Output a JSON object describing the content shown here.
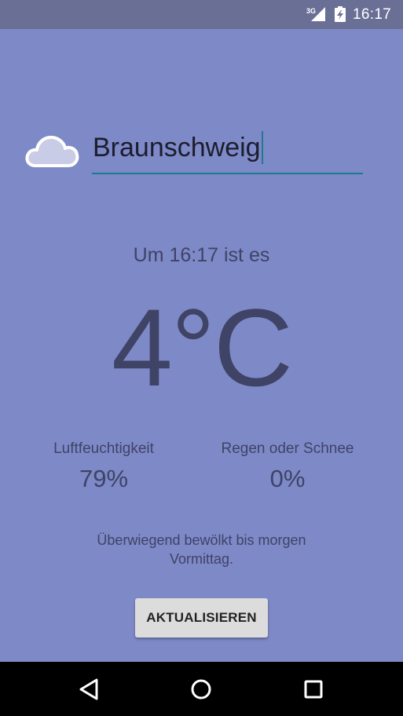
{
  "status_bar": {
    "network_badge": "3G",
    "time": "16:17",
    "signal_icon": "signal-icon",
    "battery_icon": "battery-charging-icon"
  },
  "location": {
    "weather_icon": "cloud-icon",
    "city_value": "Braunschweig"
  },
  "observation": {
    "time_prefix": "Um",
    "time": "16:17",
    "time_suffix": "ist es"
  },
  "temperature": "4°C",
  "stats": {
    "humidity_label": "Luftfeuchtigkeit",
    "humidity_value": "79%",
    "precip_label": "Regen oder Schnee",
    "precip_value": "0%"
  },
  "summary": "Überwiegend bewölkt bis morgen Vormittag.",
  "refresh_button_label": "AKTUALISIEREN",
  "nav_bar": {
    "back_icon": "back-icon",
    "home_icon": "home-icon",
    "recents_icon": "recents-icon"
  },
  "colors": {
    "background": "#7e89c7",
    "status_bar": "#6a6f95",
    "text": "#3f4366",
    "accent": "#1e7a8d",
    "button": "#dcdcdc"
  }
}
